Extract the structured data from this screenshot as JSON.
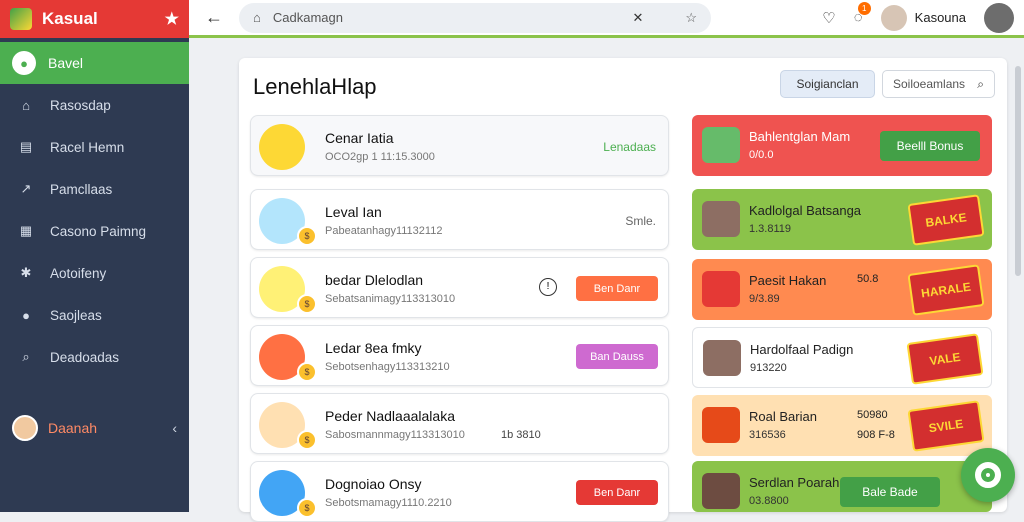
{
  "app": {
    "title": "Kasual",
    "star_icon": "star-icon"
  },
  "sidebar": {
    "active": {
      "label": "Bavel"
    },
    "items": [
      {
        "label": "Rasosdap",
        "icon": "home-icon"
      },
      {
        "label": "Racel Hemn",
        "icon": "list-icon"
      },
      {
        "label": "Pamcllaas",
        "icon": "chart-icon"
      },
      {
        "label": "Casono Paimng",
        "icon": "grid-icon"
      },
      {
        "label": "Aotoifeny",
        "icon": "settings-icon"
      },
      {
        "label": "Saojleas",
        "icon": "chat-icon"
      },
      {
        "label": "Deadoadas",
        "icon": "search-icon"
      }
    ],
    "user": {
      "label": "Daanah"
    }
  },
  "topbar": {
    "search_placeholder": "Cadkamagn",
    "user_name": "Kasouna",
    "notif_count": "1"
  },
  "panel": {
    "title": "LenehlaHlap",
    "button1": "Soigianclan",
    "button2": "Soiloeamlans"
  },
  "leaderboard": [
    {
      "name": "Cenar Iatia",
      "sub": "OCO2gp 1 11:15.3000",
      "right": "Lenadaas",
      "right_color": "#4caf50",
      "avatar_color": "#fdd835"
    },
    {
      "name": "Leval Ian",
      "sub": "Pabeatanhagy11132112",
      "right": "Smle.",
      "right_color": "#666666",
      "avatar_color": "#b3e5fc"
    },
    {
      "name": "bedar Dlelodlan",
      "sub": "Sebatsanimagy113313010",
      "btn": "Ben Danr",
      "btn_color": "#ff7043",
      "avatar_color": "#fff176"
    },
    {
      "name": "Ledar 8ea fmky",
      "sub": "Sebotsenhagy113313210",
      "btn": "Ban Dauss",
      "btn_color": "#ce6ad0",
      "avatar_color": "#ff7043"
    },
    {
      "name": "Peder Nadlaaalalaka",
      "sub": "Sabosmannmagy113313010",
      "mid": "1b 3810",
      "avatar_color": "#ffe0b2"
    },
    {
      "name": "Dognoiao Onsy",
      "sub": "Sebotsmamagy1110.2210",
      "btn": "Ben Danr",
      "btn_color": "#e53935",
      "avatar_color": "#42a5f5"
    }
  ],
  "rewards": [
    {
      "title": "Bahlentglan Mam",
      "sub": "0/0.0",
      "btn": "Beelll Bonus",
      "btn_color": "#43a047",
      "bg": "#ef5350",
      "icon_color": "#66bb6a"
    },
    {
      "title": "Kadlolgal Batsanga",
      "sub": "1.3.8119",
      "bg": "#8bc34a",
      "icon_color": "#8d6e63",
      "sticker": "BALKE"
    },
    {
      "title": "Paesit Hakan",
      "sub": "9/3.89",
      "mid": "50.8",
      "bg": "#ff8a50",
      "icon_color": "#e53935",
      "sticker": "HARALE"
    },
    {
      "title": "Hardolfaal Padign",
      "sub": "913220",
      "bg": "#ffffff",
      "icon_color": "#8d6e63",
      "sticker": "VALE"
    },
    {
      "title": "Roal Barian",
      "sub": "316536",
      "mid": "50980",
      "mid2": "908 F-8",
      "bg": "#ffe0b2",
      "icon_color": "#e64a19",
      "sticker": "SVILE"
    },
    {
      "title": "Serdlan Poarah",
      "sub": "03.8800",
      "btn": "Bale Bade",
      "btn_color": "#43a047",
      "bg": "#8bc34a",
      "icon_color": "#6d4c41"
    }
  ],
  "fab": {
    "icon": "chat-bubble-icon"
  }
}
